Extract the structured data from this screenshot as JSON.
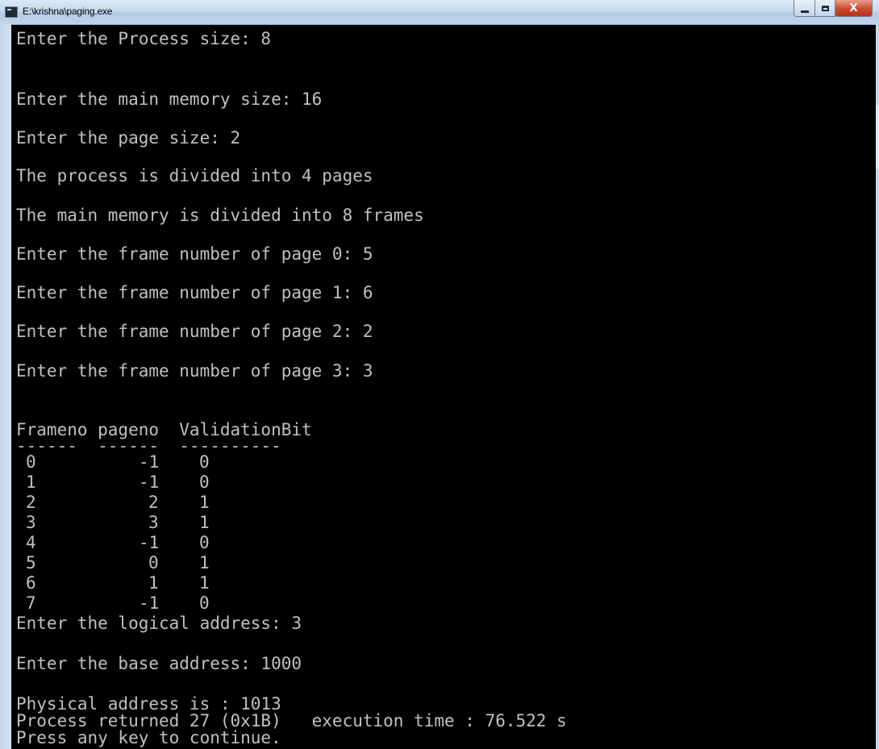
{
  "window": {
    "title": "E:\\krishna\\paging.exe",
    "close_glyph": "X"
  },
  "console": {
    "prompts": [
      "Enter the Process size: 8",
      "Enter the main memory size: 16",
      "Enter the page size: 2",
      "The process is divided into 4 pages",
      "The main memory is divided into 8 frames",
      "Enter the frame number of page 0: 5",
      "Enter the frame number of page 1: 6",
      "Enter the frame number of page 2: 2",
      "Enter the frame number of page 3: 3"
    ],
    "table_header": "Frameno pageno  ValidationBit",
    "table_divider": "------  ------  ----------",
    "table_rows": [
      {
        "frame": "0",
        "page": "-1",
        "valid": "0"
      },
      {
        "frame": "1",
        "page": "-1",
        "valid": "0"
      },
      {
        "frame": "2",
        "page": "2",
        "valid": "1"
      },
      {
        "frame": "3",
        "page": "3",
        "valid": "1"
      },
      {
        "frame": "4",
        "page": "-1",
        "valid": "0"
      },
      {
        "frame": "5",
        "page": "0",
        "valid": "1"
      },
      {
        "frame": "6",
        "page": "1",
        "valid": "1"
      },
      {
        "frame": "7",
        "page": "-1",
        "valid": "0"
      }
    ],
    "logical_prompt": "Enter the logical address: 3",
    "base_prompt": "Enter the base address: 1000",
    "physical": "Physical address is : 1013",
    "returned": "Process returned 27 (0x1B)   execution time : 76.522 s",
    "press_key": "Press any key to continue."
  },
  "colors": {
    "console_bg": "#000000",
    "console_text": "#c0c0c0",
    "titlebar": "#c6d9ee",
    "close_button": "#c84a2f"
  }
}
